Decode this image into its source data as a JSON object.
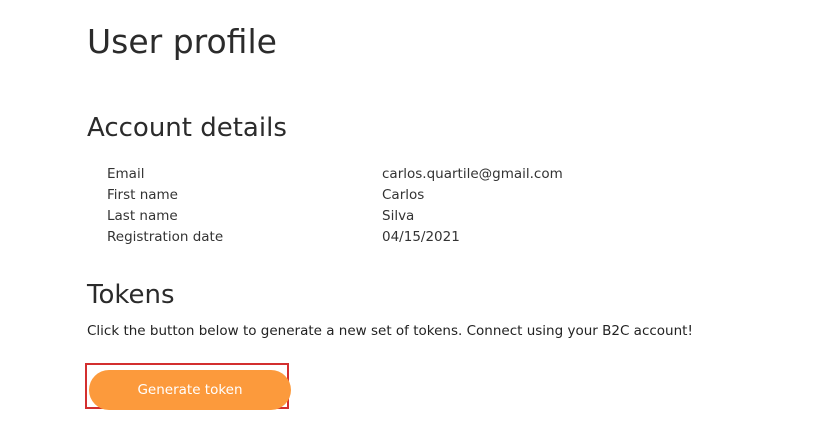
{
  "page": {
    "title": "User profile"
  },
  "account": {
    "title": "Account details",
    "rows": [
      {
        "label": "Email",
        "value": "carlos.quartile@gmail.com"
      },
      {
        "label": "First name",
        "value": "Carlos"
      },
      {
        "label": "Last name",
        "value": "Silva"
      },
      {
        "label": "Registration date",
        "value": "04/15/2021"
      }
    ]
  },
  "tokens": {
    "title": "Tokens",
    "description": "Click the button below to generate a new set of tokens. Connect using your B2C account!",
    "button_label": "Generate token"
  },
  "colors": {
    "button_bg": "#fc9a3c",
    "highlight": "#d32f2f"
  }
}
